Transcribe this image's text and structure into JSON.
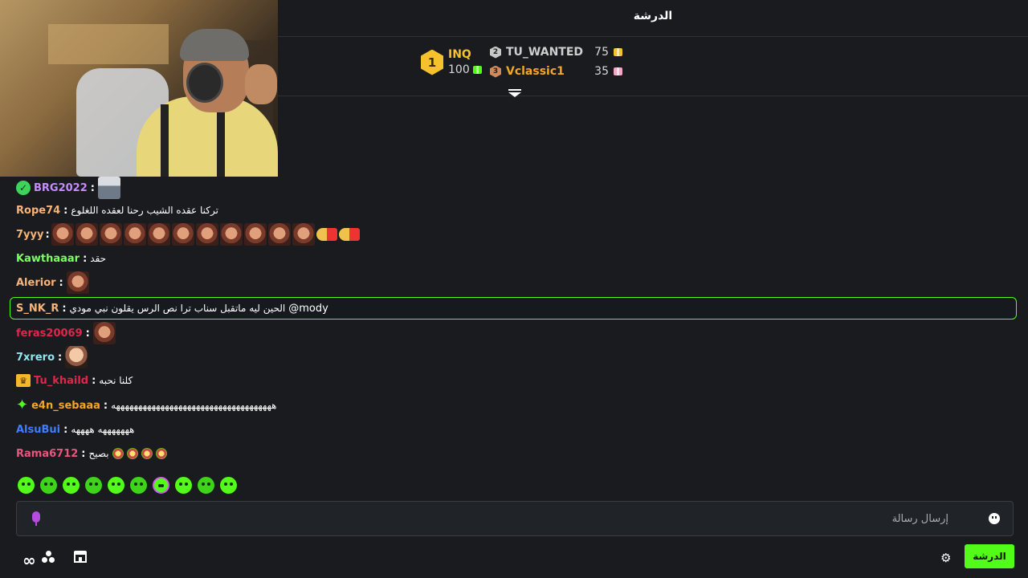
{
  "chat": {
    "title": "الدرشة"
  },
  "leaderboard": {
    "first": {
      "rank": "1",
      "name": "INQ",
      "amount": "100"
    },
    "second": {
      "rank": "2",
      "name": "TU_WANTED",
      "amount": "75"
    },
    "third": {
      "rank": "3",
      "name": "Vclassic1",
      "amount": "35"
    }
  },
  "messages": [
    {
      "user": "BRG2022",
      "color": "#c48cff",
      "text": "",
      "badge": "verified"
    },
    {
      "user": "Rope74",
      "color": "#f5b47a",
      "text": "تركنا عقده الشيب رحنا لعقده اللغلوع"
    },
    {
      "user": "7yyy",
      "color": "#f5b47a",
      "text": ""
    },
    {
      "user": "Kawthaaar",
      "color": "#7cff63",
      "text": "حقد"
    },
    {
      "user": "Alerior",
      "color": "#f5b47a",
      "text": ""
    },
    {
      "user": "S_NK_R",
      "color": "#f5b47a",
      "text": "الحين ليه ماتقبل سناب ترا نص الرس يقلون نبي مودي",
      "mention": "@mody"
    },
    {
      "user": "feras20069",
      "color": "#e0264b",
      "text": ""
    },
    {
      "user": "7xrero",
      "color": "#8ee6f0",
      "text": ""
    },
    {
      "user": "Tu_khaild",
      "color": "#e0264b",
      "text": "كلنا نحبه",
      "badge": "crown"
    },
    {
      "user": "e4n_sebaaa",
      "color": "#f5a623",
      "text": "ههههههههههههههههههههههههههههههههههههه",
      "badge": "sparkle"
    },
    {
      "user": "AlsuBui",
      "color": "#3f7cff",
      "text": "هههههههه ههههه"
    },
    {
      "user": "Rama6712",
      "color": "#e8567d",
      "text": "بصيح"
    }
  ],
  "input": {
    "placeholder": "إرسال رسالة"
  },
  "footer": {
    "chat_button": "الدرشة"
  },
  "colors": {
    "accent": "#53fc18",
    "background": "#191b1f",
    "gold": "#f5c12d"
  },
  "icons": [
    "infinity-icon",
    "dots-icon",
    "store-icon",
    "gear-icon",
    "mic-icon",
    "smile-icon",
    "collapse-icon"
  ]
}
